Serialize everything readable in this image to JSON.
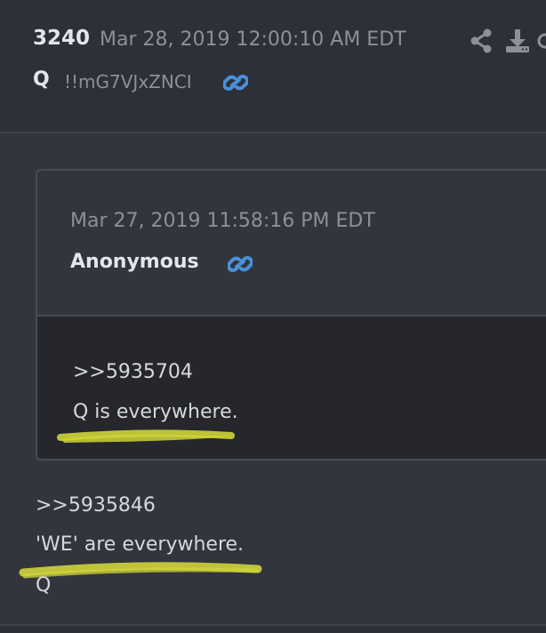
{
  "post": {
    "number": "3240",
    "date": "Mar 28, 2019 12:00:10 AM EDT",
    "author": "Q",
    "tripcode": "!!mG7VJxZNCI"
  },
  "quoted_post": {
    "date": "Mar 27, 2019 11:58:16 PM EDT",
    "author": "Anonymous",
    "reference": ">>5935704",
    "text": "Q is everywhere."
  },
  "reply": {
    "reference": ">>5935846",
    "text": "'WE' are everywhere.",
    "signature": "Q"
  },
  "icons": {
    "link": "link-icon",
    "share": "share-icon",
    "download": "download-icon",
    "more": "more-icon"
  },
  "colors": {
    "link_accent": "#4a90d9",
    "highlight": "#cfd43a",
    "background": "#2d3038",
    "quote_content_bg": "#25272d"
  }
}
